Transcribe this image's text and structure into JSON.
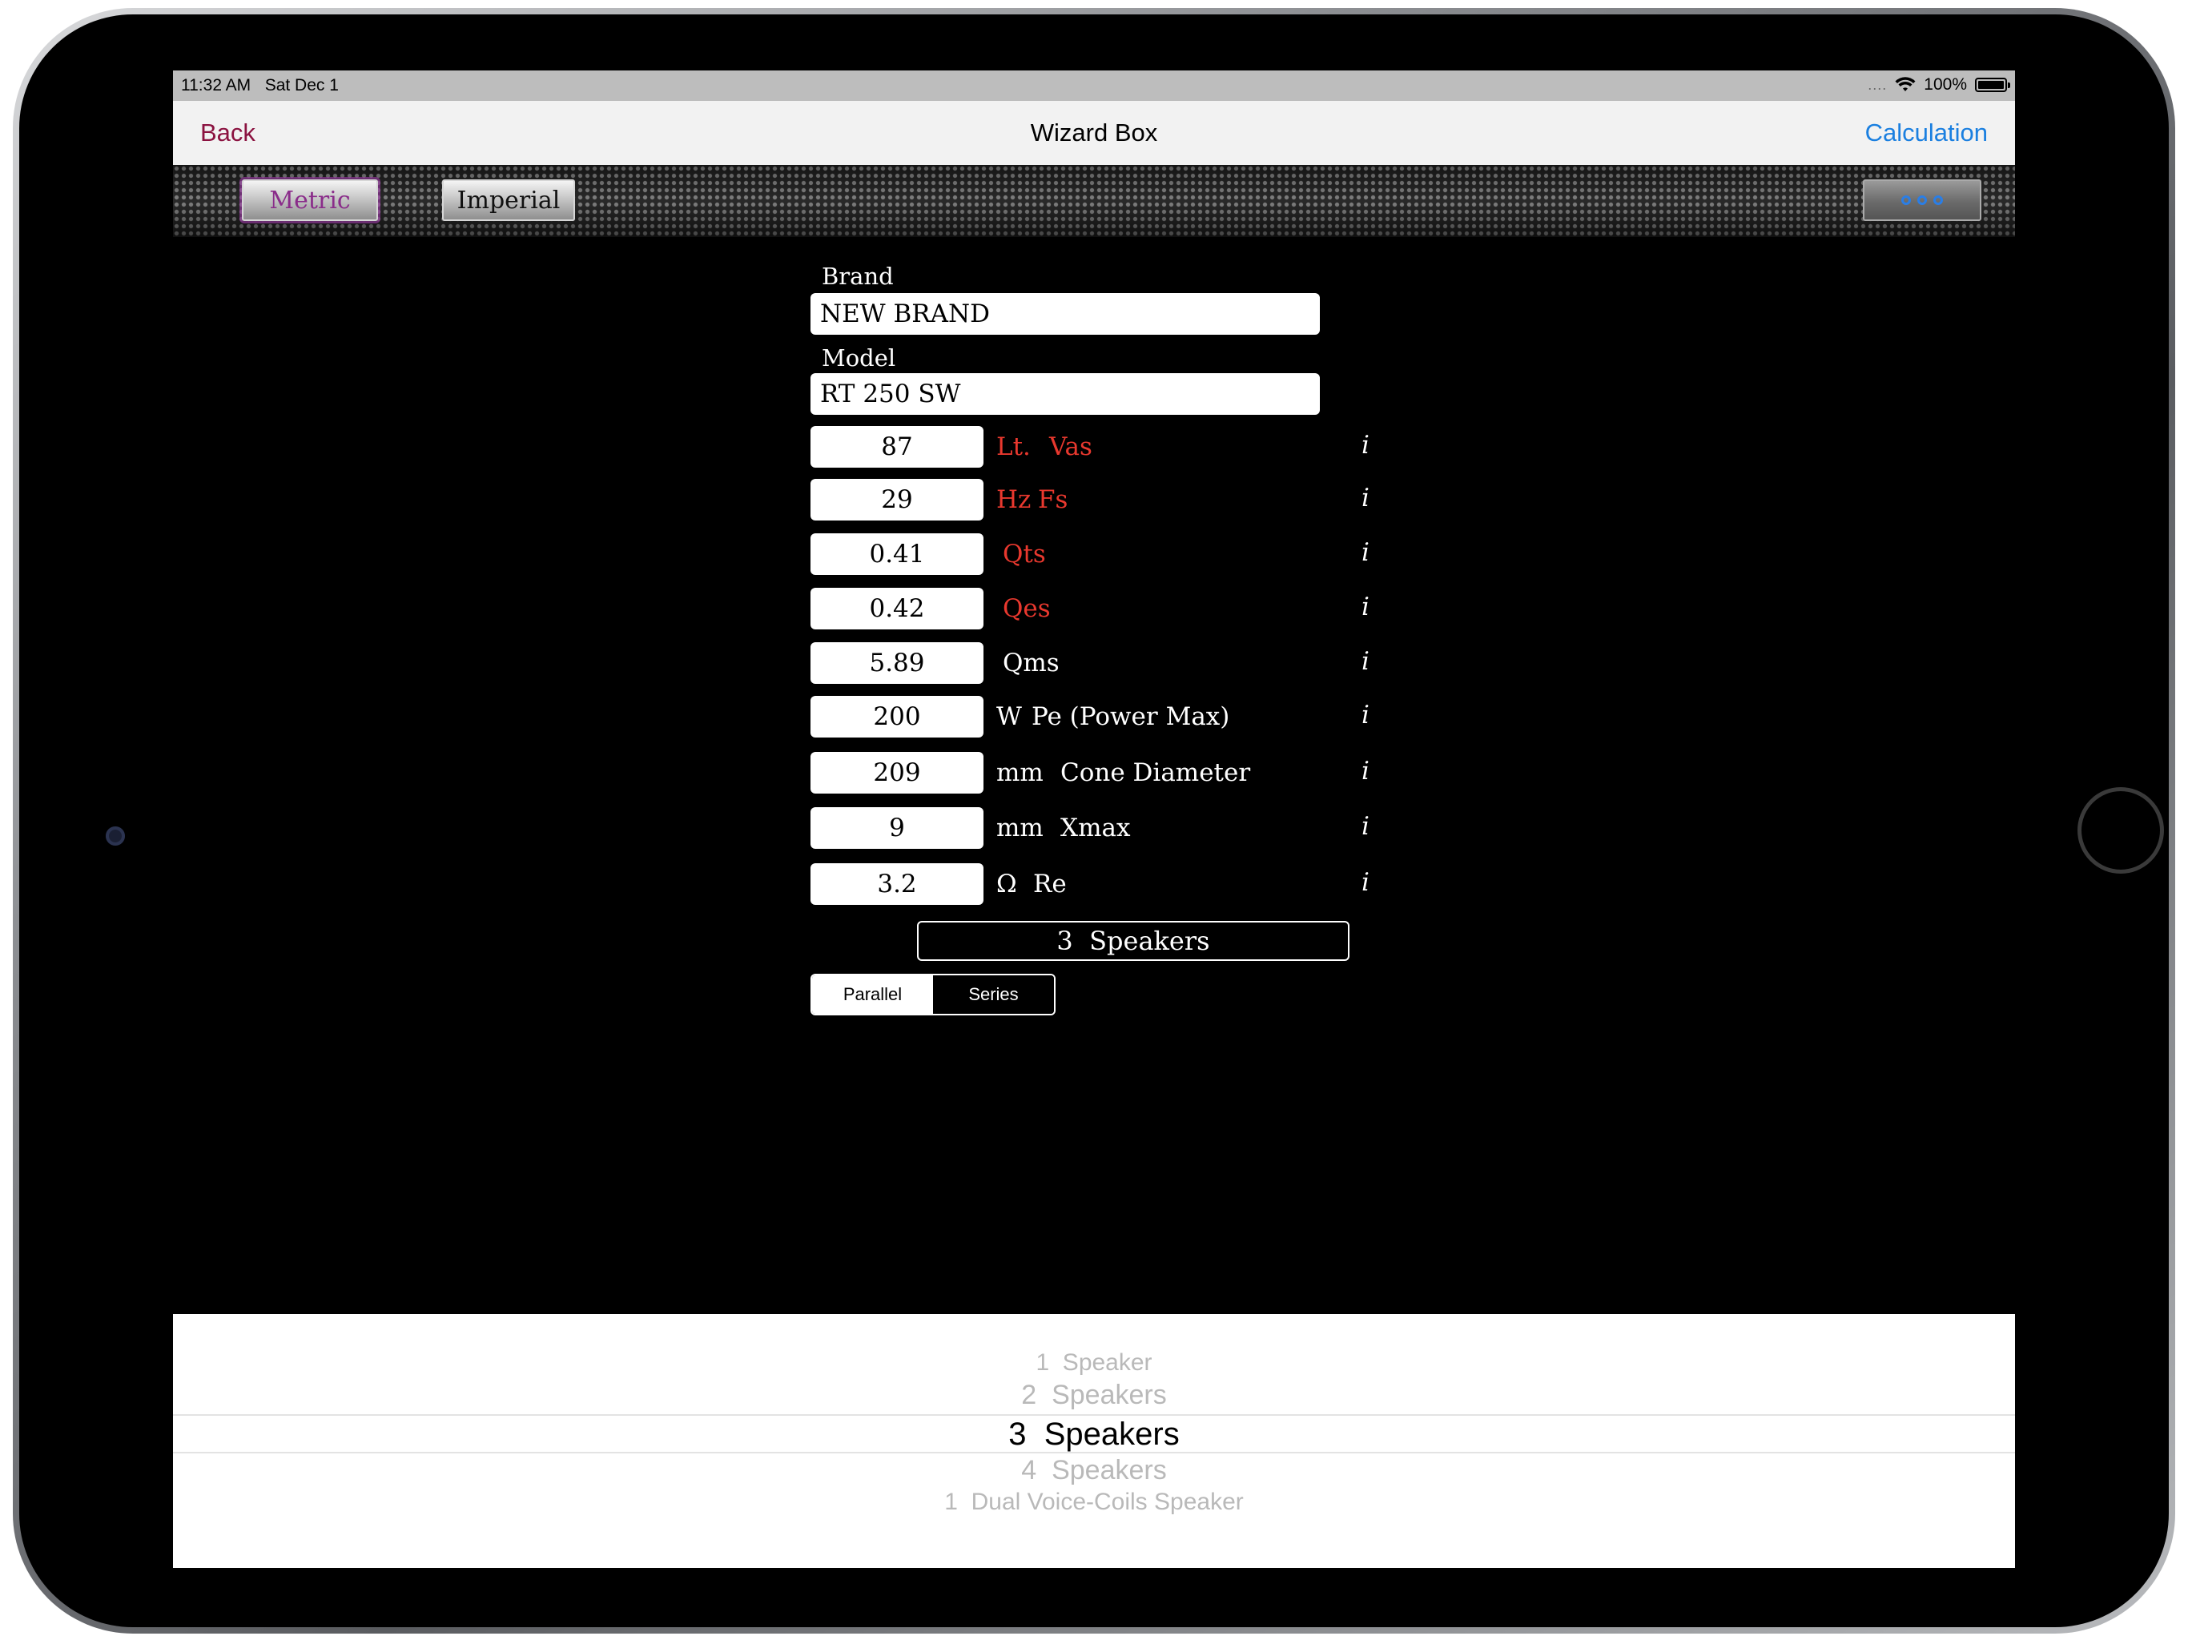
{
  "status_bar": {
    "time": "11:32 AM",
    "date": "Sat Dec 1",
    "signal": "....",
    "battery": "100%",
    "battery_level": 1.0
  },
  "nav": {
    "back": "Back",
    "title": "Wizard Box",
    "calculation": "Calculation"
  },
  "units": {
    "metric": "Metric",
    "imperial": "Imperial",
    "selected": "Metric"
  },
  "form": {
    "brand_label": "Brand",
    "brand_value": "NEW BRAND",
    "model_label": "Model",
    "model_value": "RT 250 SW",
    "info_glyph": "i",
    "params": [
      {
        "value": "87",
        "unit": "Lt.",
        "name": "Vas"
      },
      {
        "value": "29",
        "unit": "Hz",
        "name": "Fs"
      },
      {
        "value": "0.41",
        "unit": "",
        "name": "Qts"
      },
      {
        "value": "0.42",
        "unit": "",
        "name": "Qes"
      },
      {
        "value": "5.89",
        "unit": "",
        "name": "Qms"
      },
      {
        "value": "200",
        "unit": "W",
        "name": "Pe (Power Max)"
      },
      {
        "value": "209",
        "unit": "mm",
        "name": "Cone Diameter"
      },
      {
        "value": "9",
        "unit": "mm",
        "name": "Xmax"
      },
      {
        "value": "3.2",
        "unit": "Ω",
        "name": "Re"
      }
    ],
    "speakers_button": "3  Speakers",
    "wiring": {
      "parallel": "Parallel",
      "series": "Series",
      "selected": "Series"
    }
  },
  "picker": {
    "items": [
      "1  Speaker",
      "2  Speakers",
      "3  Speakers",
      "4  Speakers",
      "1  Dual Voice-Coils Speaker"
    ],
    "selected_index": 2
  },
  "colors": {
    "accent_back": "#8b1240",
    "accent_link": "#1a7fe0",
    "required_param": "#e8382e",
    "metric_text": "#8a2c8a"
  }
}
